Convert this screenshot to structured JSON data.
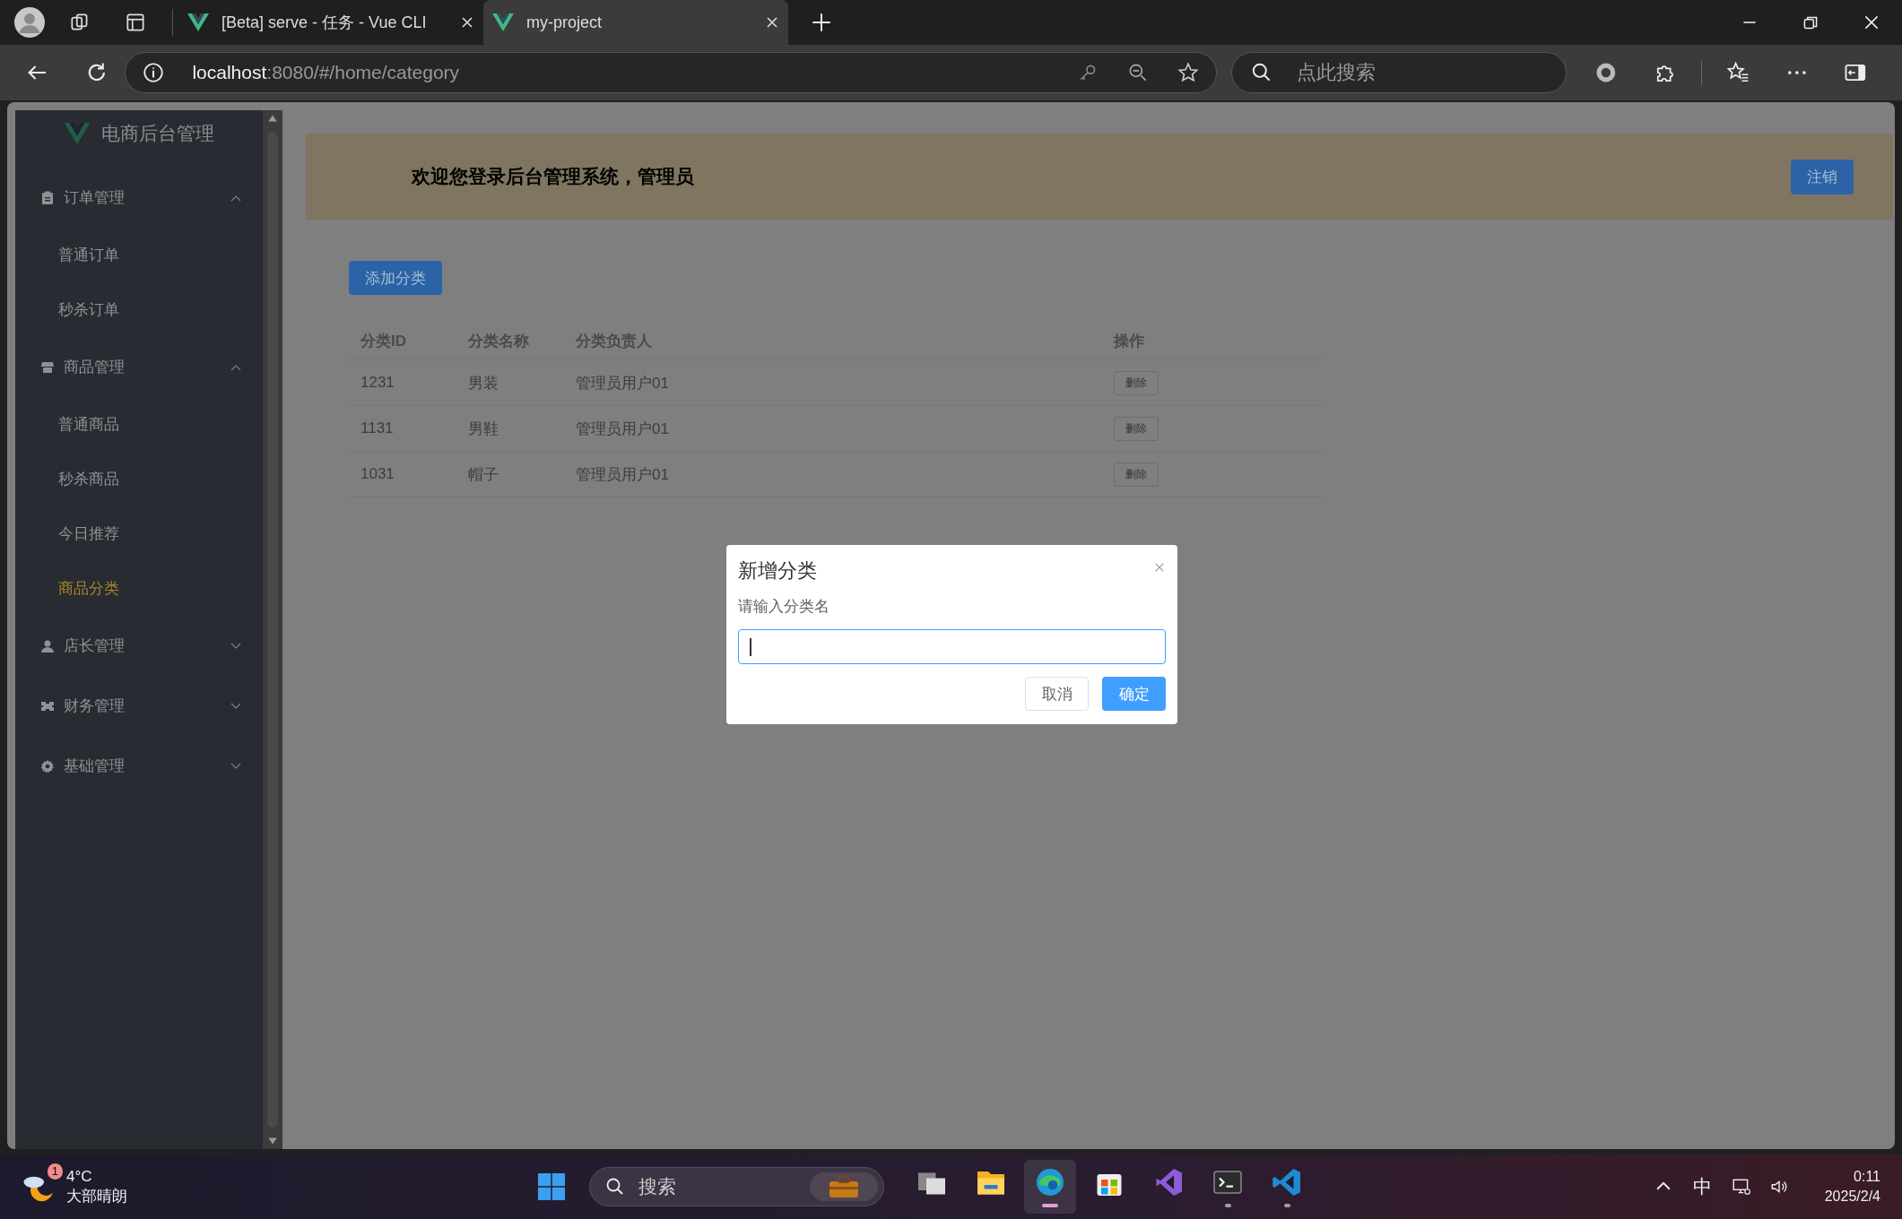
{
  "browser": {
    "tabs": [
      {
        "title": "[Beta] serve - 任务 - Vue CLI",
        "selected": false
      },
      {
        "title": "my-project",
        "selected": true
      }
    ],
    "address": {
      "host": "localhost",
      "rest": ":8080/#/home/category"
    },
    "search": {
      "placeholder": "点此搜索"
    }
  },
  "sidebar": {
    "logo_text": "电商后台管理",
    "menu": [
      {
        "label": "订单管理",
        "expanded": true,
        "children": [
          {
            "label": "普通订单",
            "selected": false
          },
          {
            "label": "秒杀订单",
            "selected": false
          }
        ]
      },
      {
        "label": "商品管理",
        "expanded": true,
        "children": [
          {
            "label": "普通商品",
            "selected": false
          },
          {
            "label": "秒杀商品",
            "selected": false
          },
          {
            "label": "今日推荐",
            "selected": false
          },
          {
            "label": "商品分类",
            "selected": true
          }
        ]
      },
      {
        "label": "店长管理",
        "expanded": false
      },
      {
        "label": "财务管理",
        "expanded": false
      },
      {
        "label": "基础管理",
        "expanded": false
      }
    ]
  },
  "header": {
    "welcome": "欢迎您登录后台管理系统，管理员",
    "logout_button": "注销"
  },
  "add_button": "添加分类",
  "table": {
    "columns": [
      "分类ID",
      "分类名称",
      "分类负责人",
      "操作"
    ],
    "rows": [
      {
        "id": "1231",
        "name": "男装",
        "owner": "管理员用户01",
        "action": "删除"
      },
      {
        "id": "1131",
        "name": "男鞋",
        "owner": "管理员用户01",
        "action": "删除"
      },
      {
        "id": "1031",
        "name": "帽子",
        "owner": "管理员用户01",
        "action": "删除"
      }
    ]
  },
  "dialog": {
    "title": "新增分类",
    "label": "请输入分类名",
    "cancel_button": "取消",
    "confirm_button": "确定"
  },
  "taskbar": {
    "weather": {
      "badge": "1",
      "temperature": "4°C",
      "condition": "大部晴朗"
    },
    "search": {
      "placeholder": "搜索"
    },
    "apps": [
      {
        "selected": false,
        "running": false
      },
      {
        "selected": false,
        "running": false
      },
      {
        "selected": true,
        "running": true
      },
      {
        "selected": false,
        "running": false
      },
      {
        "selected": false,
        "running": false
      },
      {
        "selected": false,
        "running": true
      },
      {
        "selected": false,
        "running": true
      }
    ],
    "tray": {
      "ime": "中",
      "time": "0:11",
      "date": "2025/2/4"
    }
  }
}
